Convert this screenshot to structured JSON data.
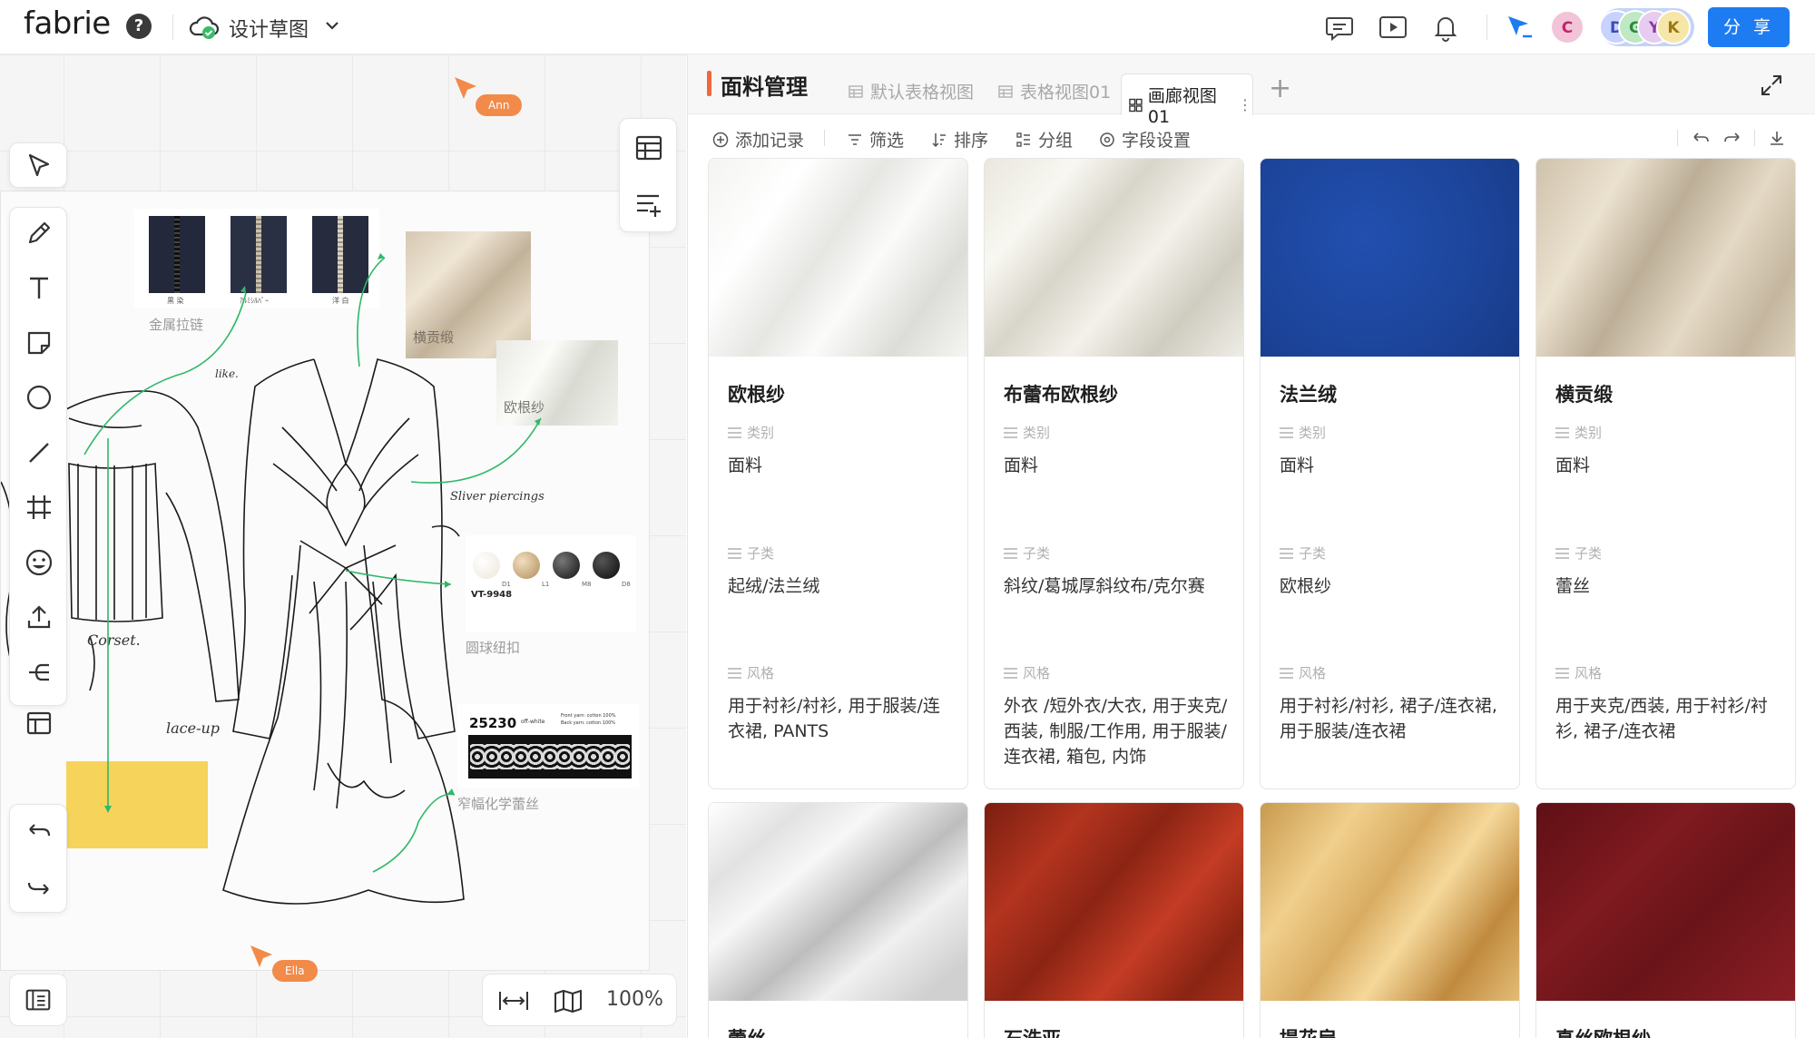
{
  "app": {
    "logo": "fabrie",
    "doc_title": "设计草图",
    "share_label": "分 享"
  },
  "avatars": [
    {
      "letter": "C",
      "color": "#f2c4d8",
      "text": "#c2256a"
    },
    {
      "letter": "D",
      "color": "#c8d2ff",
      "text": "#3a4bb5"
    },
    {
      "letter": "G",
      "color": "#bfe8c4",
      "text": "#2d8a3c"
    },
    {
      "letter": "Y",
      "color": "#e7cbf0",
      "text": "#8c3aa6"
    },
    {
      "letter": "K",
      "color": "#f6e6a8",
      "text": "#9a7a10"
    }
  ],
  "canvas": {
    "cursors": [
      "Ann",
      "Ella"
    ],
    "labels": {
      "zipper": "金属拉链",
      "satin": "横贡缎",
      "organza": "欧根纱",
      "buttons": "圆球纽扣",
      "lace": "窄幅化学蕾丝",
      "sketch_note_1": "Corset.",
      "sketch_note_2": "lace-up",
      "sketch_note_3": "Sliver piercings",
      "sketch_note_4": "like.",
      "zipper_tags": [
        "黒 染",
        "ｱﾙﾐｼﾙﾊﾞｰ",
        "洋 白"
      ],
      "button_code": "VT-9948",
      "button_sizes": [
        "D1",
        "L1",
        "M8",
        "D8"
      ],
      "lace_code": "25230",
      "lace_sub": "off-white",
      "lace_spec": "Front yarn: cotton 100%",
      "lace_spec2": "Back yarn: cotton 100%"
    },
    "zoom": "100%"
  },
  "panel": {
    "title": "面料管理",
    "tabs": [
      "默认表格视图",
      "表格视图01",
      "画廊视图01"
    ],
    "actions": [
      "添加记录",
      "筛选",
      "排序",
      "分组",
      "字段设置"
    ],
    "field_labels": {
      "category": "类别",
      "subcategory": "子类",
      "style": "风格"
    },
    "cards": [
      {
        "title": "欧根纱",
        "category": "面料",
        "subcategory": "起绒/法兰绒",
        "style": "用于衬衫/衬衫, 用于服装/连衣裙, PANTS",
        "img": "white-drape"
      },
      {
        "title": "布蕾布欧根纱",
        "category": "面料",
        "subcategory": "斜纹/葛城厚斜纹布/克尔赛",
        "style": "外衣 /短外衣/大衣, 用于夹克/西装, 制服/工作用, 用于服装/连衣裙, 箱包, 内饰",
        "img": "ivory-silk"
      },
      {
        "title": "法兰绒",
        "category": "面料",
        "subcategory": "欧根纱",
        "style": "用于衬衫/衬衫, 裙子/连衣裙, 用于服装/连衣裙",
        "img": "royal-blue"
      },
      {
        "title": "横贡缎",
        "category": "面料",
        "subcategory": "蕾丝",
        "style": "用于夹克/西装, 用于衬衫/衬衫, 裙子/连衣裙",
        "img": "beige-satin"
      },
      {
        "title": "蕾丝",
        "img": "sheer-white"
      },
      {
        "title": "石洗亚",
        "img": "rust-red"
      },
      {
        "title": "提花扇",
        "img": "gold-satin"
      },
      {
        "title": "真丝欧根纱",
        "img": "burgundy"
      }
    ]
  },
  "colors": {
    "accent": "#f1673c",
    "share": "#1e7cf3",
    "cursor": "#f28a4a"
  }
}
